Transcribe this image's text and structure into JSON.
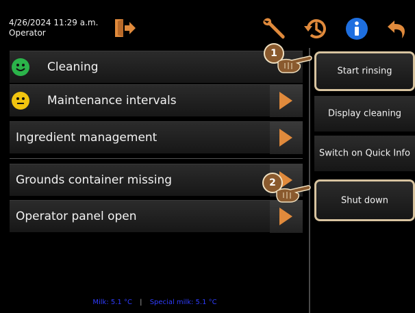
{
  "header": {
    "date_time": "4/26/2024 11:29 a.m.",
    "user": "Operator",
    "icons": [
      "logout-icon",
      "wrench-icon",
      "history-icon",
      "info-icon",
      "back-icon"
    ],
    "info_color": "#1e6fe0",
    "accent_color": "#e08a3c"
  },
  "list": {
    "items": [
      {
        "label": "Cleaning",
        "status": "green"
      },
      {
        "label": "Maintenance intervals",
        "status": "yellow"
      },
      {
        "label": "Ingredient management"
      },
      {
        "label": "Grounds container missing"
      },
      {
        "label": "Operator panel open"
      }
    ]
  },
  "right_menu": {
    "buttons": [
      {
        "label": "Start rinsing"
      },
      {
        "label": "Display cleaning"
      },
      {
        "label": "Switch on Quick Info"
      },
      {
        "label": "Shut down"
      }
    ]
  },
  "callouts": [
    "1",
    "2"
  ],
  "footer": {
    "milk": "Milk: 5.1 °C",
    "separator": "|",
    "special_milk": "Special milk: 5.1 °C"
  }
}
